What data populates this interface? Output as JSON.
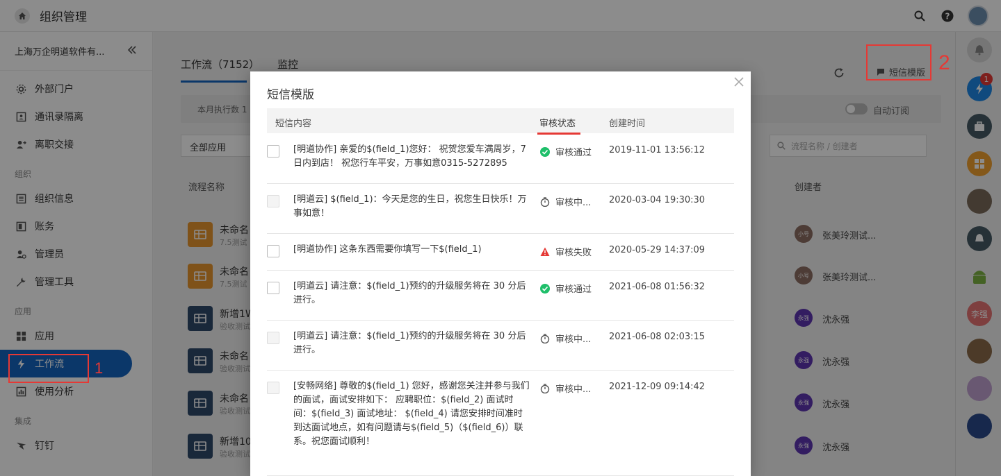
{
  "topbar": {
    "title": "组织管理"
  },
  "sidebar": {
    "org_name": "上海万企明道软件有...",
    "items_top": [
      {
        "label": "外部门户",
        "icon": "gear-icon"
      },
      {
        "label": "通讯录隔离",
        "icon": "contacts-icon"
      },
      {
        "label": "离职交接",
        "icon": "user-transfer-icon"
      }
    ],
    "section_org": "组织",
    "items_org": [
      {
        "label": "组织信息",
        "icon": "doc-icon"
      },
      {
        "label": "账务",
        "icon": "wallet-icon"
      },
      {
        "label": "管理员",
        "icon": "admin-icon"
      },
      {
        "label": "管理工具",
        "icon": "wrench-icon"
      }
    ],
    "section_app": "应用",
    "items_app": [
      {
        "label": "应用",
        "icon": "apps-icon"
      },
      {
        "label": "工作流",
        "icon": "workflow-icon"
      },
      {
        "label": "使用分析",
        "icon": "chart-icon"
      }
    ],
    "section_integration": "集成",
    "items_integration": [
      {
        "label": "钉钉",
        "icon": "dingtalk-icon"
      }
    ],
    "annotation_1": "1"
  },
  "main": {
    "tabs": [
      {
        "label": "工作流（7152）"
      },
      {
        "label": "监控"
      }
    ],
    "sms_template_label": "短信模版",
    "annotation_2": "2",
    "stats_label": "本月执行数 1",
    "auto_subscribe": "自动订阅",
    "filter_value": "全部应用",
    "search_placeholder": "流程名称 / 创建者",
    "col_name": "流程名称",
    "col_creator": "创建者",
    "rows": [
      {
        "name": "未命名",
        "sub": "7.5测试",
        "color": "#e8962e",
        "creator": "张美玲测试...",
        "creator_av": "小号"
      },
      {
        "name": "未命名",
        "sub": "7.5测试",
        "color": "#e8962e",
        "creator": "张美玲测试...",
        "creator_av": "小号"
      },
      {
        "name": "新增1W",
        "sub": "验收测试",
        "color": "#2f4a6b",
        "creator": "沈永强",
        "creator_av": "永强"
      },
      {
        "name": "未命名",
        "sub": "验收测试",
        "color": "#2f4a6b",
        "creator": "沈永强",
        "creator_av": "永强"
      },
      {
        "name": "未命名",
        "sub": "验收测试",
        "color": "#2f4a6b",
        "creator": "沈永强",
        "creator_av": "永强"
      },
      {
        "name": "新增10",
        "sub": "验收测试",
        "color": "#2f4a6b",
        "creator": "沈永强",
        "creator_av": "永强"
      }
    ]
  },
  "rail": {
    "badge": "1",
    "avatar_li": "李强"
  },
  "modal": {
    "title": "短信模版",
    "col_content": "短信内容",
    "col_status": "审核状态",
    "col_time": "创建时间",
    "rows": [
      {
        "content": "[明道协作] 亲爱的$(field_1)您好： 祝贺您爱车满周岁，7日内到店！ 祝您行车平安，万事如意0315-5272895",
        "status": "审核通过",
        "status_type": "pass",
        "time": "2019-11-01 13:56:12",
        "disabled": false
      },
      {
        "content": "[明道云] $(field_1)：今天是您的生日，祝您生日快乐！万事如意！",
        "status": "审核中...",
        "status_type": "pending",
        "time": "2020-03-04 19:30:30",
        "disabled": true
      },
      {
        "content": "[明道协作] 这条东西需要你填写一下$(field_1)",
        "status": "审核失败",
        "status_type": "fail",
        "time": "2020-05-29 14:37:09",
        "disabled": false
      },
      {
        "content": "[明道云] 请注意：$(field_1)预约的升级服务将在 30 分后进行。",
        "status": "审核通过",
        "status_type": "pass",
        "time": "2021-06-08 01:56:32",
        "disabled": false
      },
      {
        "content": "[明道云] 请注意：$(field_1)预约的升级服务将在 30 分后进行。",
        "status": "审核中...",
        "status_type": "pending",
        "time": "2021-06-08 02:03:15",
        "disabled": true
      },
      {
        "content": "[安畅网络] 尊敬的$(field_1) 您好，感谢您关注并参与我们的面试，面试安排如下： 应聘职位：$(field_2) 面试时间：$(field_3) 面试地址： $(field_4) 请您安排时间准时到达面试地点，如有问题请与$(field_5)（$(field_6)）联系。祝您面试顺利！",
        "status": "审核中...",
        "status_type": "pending",
        "time": "2021-12-09 09:14:42",
        "disabled": true
      }
    ]
  }
}
